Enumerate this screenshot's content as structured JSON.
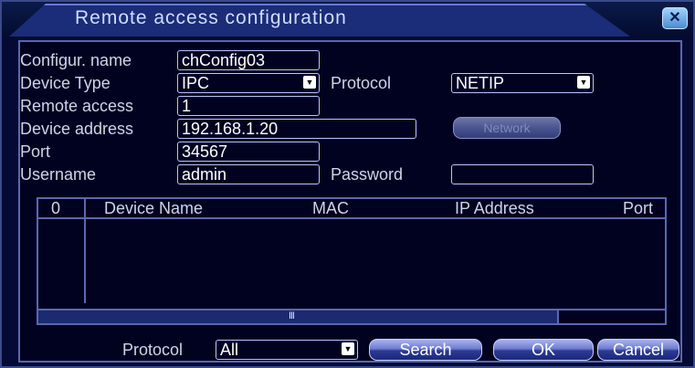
{
  "window": {
    "title": "Remote access configuration",
    "close_glyph": "✕"
  },
  "form": {
    "config_name_label": "Configur. name",
    "config_name_value": "chConfig03",
    "device_type_label": "Device Type",
    "device_type_value": "IPC",
    "protocol_label": "Protocol",
    "protocol_value": "NETIP",
    "remote_access_label": "Remote access",
    "remote_access_value": "1",
    "device_address_label": "Device address",
    "device_address_value": "192.168.1.20",
    "network_button": "Network",
    "port_label": "Port",
    "port_value": "34567",
    "username_label": "Username",
    "username_value": "admin",
    "password_label": "Password",
    "password_value": ""
  },
  "table": {
    "columns": [
      "0",
      "Device Name",
      "MAC",
      "IP Address",
      "Port"
    ],
    "rows": [],
    "scroll_grip": "Ⅲ"
  },
  "footer": {
    "protocol_label": "Protocol",
    "protocol_value": "All",
    "search_button": "Search",
    "ok_button": "OK",
    "cancel_button": "Cancel"
  },
  "colors": {
    "accent": "#1b2c78",
    "background": "#040a33",
    "border": "#5a68b0"
  }
}
